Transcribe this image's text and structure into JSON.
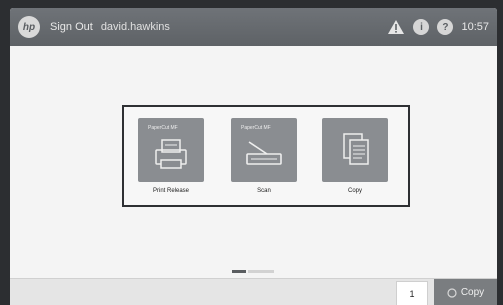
{
  "header": {
    "logo": "hp",
    "sign_out": "Sign Out",
    "username": "david.hawkins",
    "info_icon": "i",
    "help_icon": "?",
    "time": "10:57"
  },
  "tiles": [
    {
      "badge": "PaperCut MF",
      "label": "Print Release",
      "icon": "print-release-icon"
    },
    {
      "badge": "PaperCut MF",
      "label": "Scan",
      "icon": "scanner-icon"
    },
    {
      "badge": "",
      "label": "Copy",
      "icon": "copy-documents-icon"
    }
  ],
  "pager": {
    "pages": 2,
    "active": 1
  },
  "bottom": {
    "copies_value": "1",
    "copy_label": "Copy"
  }
}
